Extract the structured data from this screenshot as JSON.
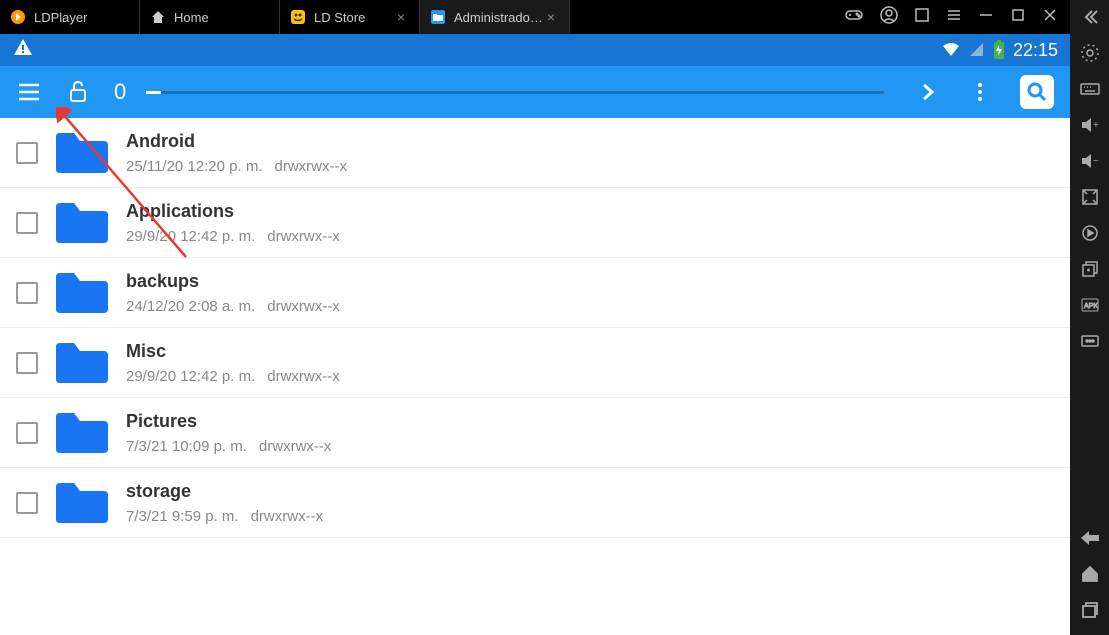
{
  "tabs": [
    {
      "label": "LDPlayer",
      "closable": false
    },
    {
      "label": "Home",
      "closable": false
    },
    {
      "label": "LD Store",
      "closable": true
    },
    {
      "label": "Administrado…",
      "closable": true,
      "active": true
    }
  ],
  "status_bar": {
    "time": "22:15"
  },
  "app_bar": {
    "path": "0"
  },
  "files": [
    {
      "name": "Android",
      "date": "25/11/20 12:20 p. m.",
      "perms": "drwxrwx--x"
    },
    {
      "name": "Applications",
      "date": "29/9/20 12:42 p. m.",
      "perms": "drwxrwx--x"
    },
    {
      "name": "backups",
      "date": "24/12/20 2:08 a. m.",
      "perms": "drwxrwx--x"
    },
    {
      "name": "Misc",
      "date": "29/9/20 12:42 p. m.",
      "perms": "drwxrwx--x"
    },
    {
      "name": "Pictures",
      "date": "7/3/21 10:09 p. m.",
      "perms": "drwxrwx--x"
    },
    {
      "name": "storage",
      "date": "7/3/21 9:59 p. m.",
      "perms": "drwxrwx--x"
    }
  ]
}
